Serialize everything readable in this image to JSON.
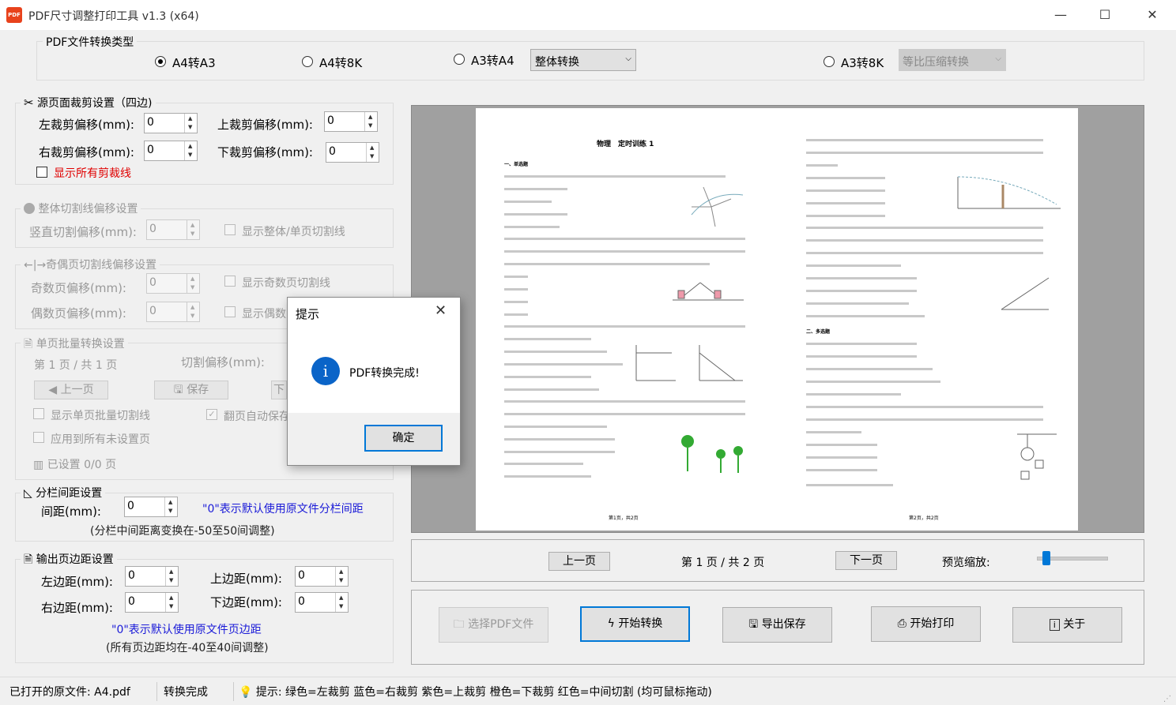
{
  "window": {
    "title": "PDF尺寸调整打印工具 v1.3   (x64)",
    "icon_text": "PDF",
    "minimize": "—",
    "maximize": "☐",
    "close": "✕"
  },
  "conversion_type": {
    "label": "PDF文件转换类型",
    "options": [
      "A4转A3",
      "A4转8K",
      "A3转A4",
      "A3转8K"
    ],
    "selected": "A4转A3",
    "a3a4_mode": "整体转换",
    "a38k_mode": "等比压缩转换"
  },
  "crop": {
    "label": "源页面裁剪设置（四边)",
    "left_label": "左裁剪偏移(mm):",
    "left": "0",
    "top_label": "上裁剪偏移(mm):",
    "top": "0",
    "right_label": "右裁剪偏移(mm):",
    "right": "0",
    "bottom_label": "下裁剪偏移(mm):",
    "bottom": "0",
    "show_lines": "显示所有剪裁线"
  },
  "cut_offset": {
    "label": "整体切割线偏移设置",
    "vertical_label": "竖直切割偏移(mm):",
    "vertical": "0",
    "show": "显示整体/单页切割线"
  },
  "odd_even": {
    "label": "←|→奇偶页切割线偏移设置",
    "odd_label": "奇数页偏移(mm):",
    "odd": "0",
    "even_label": "偶数页偏移(mm):",
    "even": "0",
    "show_odd": "显示奇数页切割线",
    "show_even": "显示偶数页切割线"
  },
  "batch": {
    "label": "单页批量转换设置",
    "page_info": "第 1 页 / 共 1 页",
    "offset_label": "切割偏移(mm):",
    "prev": "◀ 上一页",
    "save": "保存",
    "next": "下",
    "show_lines": "显示单页批量切割线",
    "auto_save": "翻页自动保存",
    "apply_all": "应用到所有未设置页",
    "set_count": "已设置 0/0 页"
  },
  "column_gap": {
    "label": "分栏间距设置",
    "gap_label": "间距(mm):",
    "gap": "0",
    "hint": "\"0\"表示默认使用原文件分栏间距",
    "range": "(分栏中间距离变换在-50至50间调整)"
  },
  "margins": {
    "label": "输出页边距设置",
    "left_label": "左边距(mm):",
    "left": "0",
    "top_label": "上边距(mm):",
    "top": "0",
    "right_label": "右边距(mm):",
    "right": "0",
    "bottom_label": "下边距(mm):",
    "bottom": "0",
    "hint": "\"0\"表示默认使用原文件页边距",
    "range": "(所有页边距均在-40至40间调整)"
  },
  "preview": {
    "doc_title": "物理　定时训练 1",
    "section1": "一、单选题",
    "section2": "二、多选题",
    "footer_left": "第1页，共2页",
    "footer_right": "第2页，共2页"
  },
  "nav": {
    "prev": "上一页",
    "page_info": "第 1 页 / 共 2 页",
    "next": "下一页",
    "zoom_label": "预览缩放:",
    "zoom_level": 0.15
  },
  "actions": {
    "select": "选择PDF文件",
    "convert": "开始转换",
    "export": "导出保存",
    "print": "开始打印",
    "about": "关于"
  },
  "status": {
    "file": "已打开的原文件: A4.pdf",
    "state": "转换完成",
    "tip": "提示: 绿色=左裁剪 蓝色=右裁剪 紫色=上裁剪 橙色=下裁剪 红色=中间切割 (均可鼠标拖动)"
  },
  "dialog": {
    "title": "提示",
    "message": "PDF转换完成!",
    "ok": "确定",
    "info_icon": "i"
  }
}
